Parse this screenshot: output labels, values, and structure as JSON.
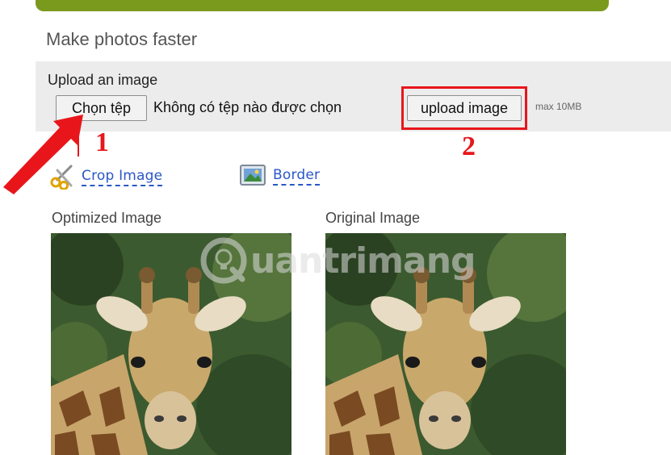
{
  "page": {
    "title": "Make photos faster"
  },
  "upload": {
    "label": "Upload an image",
    "choose_file_button": "Chọn tệp",
    "no_file_text": "Không có tệp nào được chọn",
    "upload_button": "upload image",
    "max_size": "max 10MB"
  },
  "annotations": {
    "step1": "1",
    "step2": "2",
    "color": "#e8161b"
  },
  "tools": {
    "crop_label": "Crop Image",
    "border_label": "Border",
    "crop_icon": "scissors-icon",
    "border_icon": "picture-frame-icon"
  },
  "images": {
    "optimized_caption": "Optimized Image",
    "original_caption": "Original Image",
    "subject": "giraffe-photo"
  },
  "watermark": {
    "text": "uantrimang",
    "logo_letter": "Q"
  },
  "colors": {
    "accent_green": "#7a9a1e",
    "link_blue": "#2a57c7",
    "panel_gray": "#ececec"
  }
}
